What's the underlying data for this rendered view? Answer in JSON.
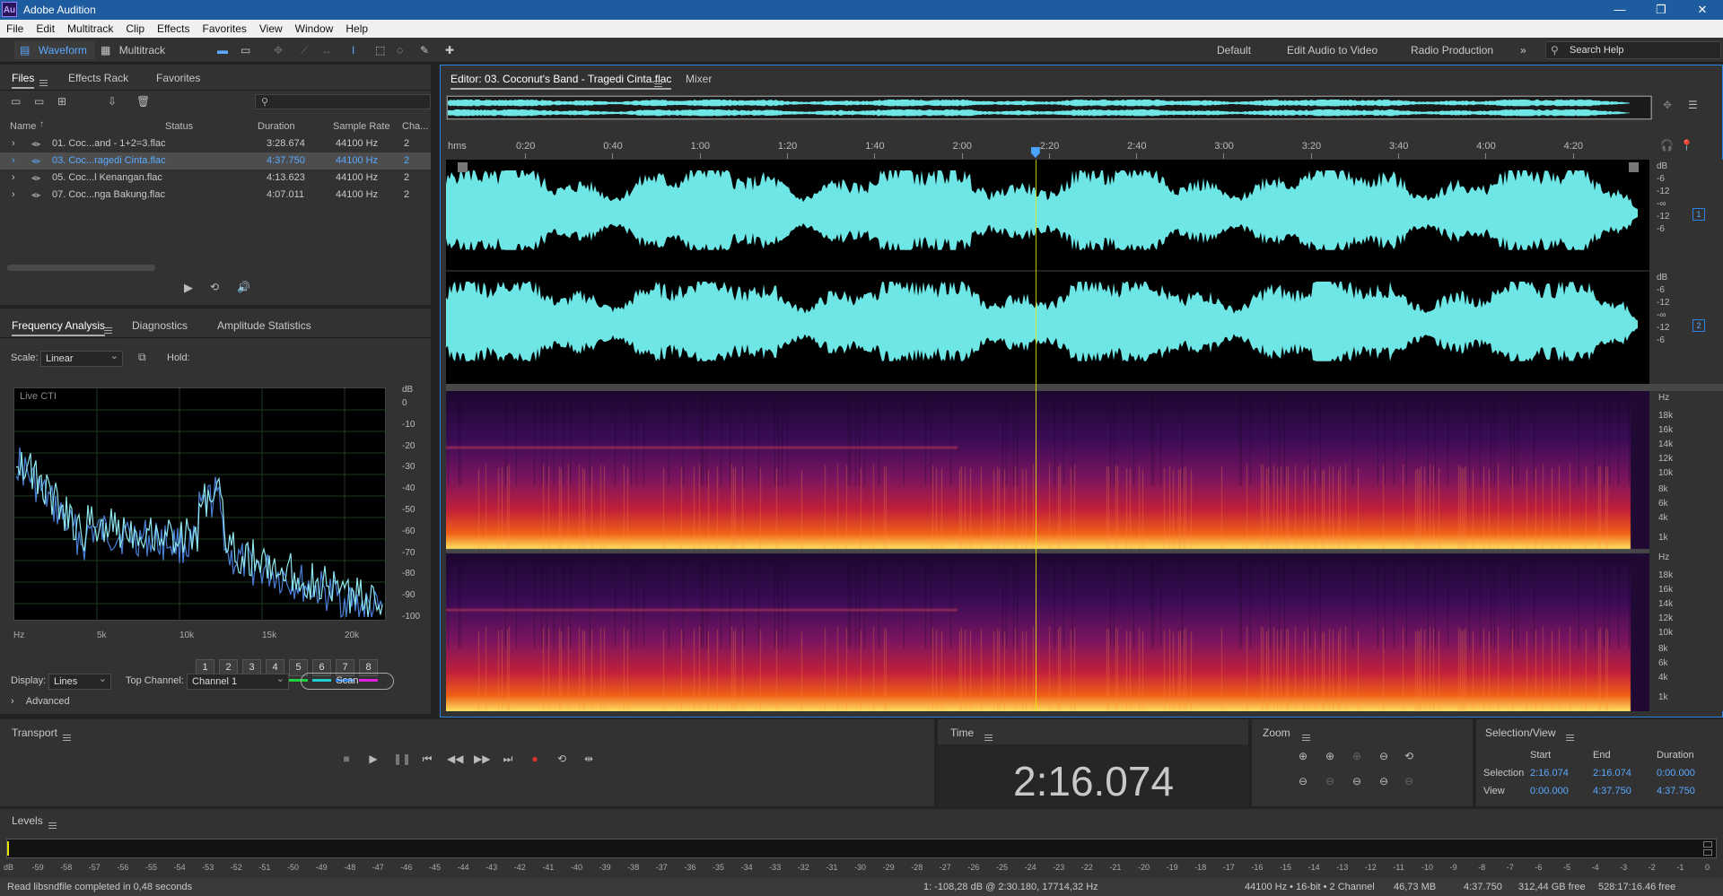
{
  "app": {
    "title": "Adobe Audition",
    "logo": "Au"
  },
  "menu": [
    "File",
    "Edit",
    "Multitrack",
    "Clip",
    "Effects",
    "Favorites",
    "View",
    "Window",
    "Help"
  ],
  "toolbar": {
    "waveform_label": "Waveform",
    "multitrack_label": "Multitrack",
    "workspaces": [
      "Default",
      "Edit Audio to Video",
      "Radio Production"
    ],
    "search_placeholder": "Search Help"
  },
  "files_panel": {
    "tabs": [
      "Files",
      "Effects Rack",
      "Favorites"
    ],
    "columns": [
      "Name",
      "Status",
      "Duration",
      "Sample Rate",
      "Cha..."
    ],
    "rows": [
      {
        "name": "01. Coc...and - 1+2=3.flac",
        "duration": "3:28.674",
        "rate": "44100 Hz",
        "ch": "2",
        "selected": false
      },
      {
        "name": "03. Coc...ragedi Cinta.flac",
        "duration": "4:37.750",
        "rate": "44100 Hz",
        "ch": "2",
        "selected": true
      },
      {
        "name": "05. Coc...l Kenangan.flac",
        "duration": "4:13.623",
        "rate": "44100 Hz",
        "ch": "2",
        "selected": false
      },
      {
        "name": "07. Coc...nga Bakung.flac",
        "duration": "4:07.011",
        "rate": "44100 Hz",
        "ch": "2",
        "selected": false
      }
    ]
  },
  "freq_panel": {
    "tabs": [
      "Frequency Analysis",
      "Diagnostics",
      "Amplitude Statistics"
    ],
    "scale_label": "Scale:",
    "scale_value": "Linear",
    "hold_label": "Hold:",
    "hold_buttons": [
      "1",
      "2",
      "3",
      "4",
      "5",
      "6",
      "7",
      "8"
    ],
    "hold_colors": [
      "#e02020",
      "#f08020",
      "#e8e820",
      "#80e020",
      "#20d040",
      "#20d0d0",
      "#2080f0",
      "#e020e0"
    ],
    "graph_label": "Live CTI",
    "db_ticks": [
      "dB",
      "0",
      "-10",
      "-20",
      "-30",
      "-40",
      "-50",
      "-60",
      "-70",
      "-80",
      "-90",
      "-100"
    ],
    "hz_ticks": [
      "Hz",
      "5k",
      "10k",
      "15k",
      "20k"
    ],
    "display_label": "Display:",
    "display_value": "Lines",
    "top_channel_label": "Top Channel:",
    "top_channel_value": "Channel 1",
    "scan_label": "Scan",
    "advanced_label": "Advanced"
  },
  "editor": {
    "tab_title": "Editor: 03. Coconut's Band - Tragedi Cinta.flac",
    "mixer_tab": "Mixer",
    "ruler_unit": "hms",
    "ruler_ticks": [
      "0:20",
      "0:40",
      "1:00",
      "1:20",
      "1:40",
      "2:00",
      "2:20",
      "2:40",
      "3:00",
      "3:20",
      "3:40",
      "4:00",
      "4:20"
    ],
    "db_scale": [
      "dB",
      "-6",
      "-12",
      "-∞",
      "-12",
      "-6"
    ],
    "channel_badges": [
      "1",
      "2"
    ],
    "hz_scale": [
      "Hz",
      "18k",
      "16k",
      "14k",
      "12k",
      "10k",
      "8k",
      "6k",
      "4k",
      "1k"
    ],
    "playhead_fraction": 0.4898
  },
  "transport": {
    "title": "Transport"
  },
  "time_panel": {
    "title": "Time",
    "value": "2:16.074"
  },
  "zoom_panel": {
    "title": "Zoom"
  },
  "selection_panel": {
    "title": "Selection/View",
    "headers": [
      "Start",
      "End",
      "Duration"
    ],
    "rows": [
      {
        "label": "Selection",
        "start": "2:16.074",
        "end": "2:16.074",
        "duration": "0:00.000"
      },
      {
        "label": "View",
        "start": "0:00.000",
        "end": "4:37.750",
        "duration": "4:37.750"
      }
    ]
  },
  "levels": {
    "title": "Levels",
    "ticks": [
      "dB",
      "-59",
      "-58",
      "-57",
      "-56",
      "-55",
      "-54",
      "-53",
      "-52",
      "-51",
      "-50",
      "-49",
      "-48",
      "-47",
      "-46",
      "-45",
      "-44",
      "-43",
      "-42",
      "-41",
      "-40",
      "-39",
      "-38",
      "-37",
      "-36",
      "-35",
      "-34",
      "-33",
      "-32",
      "-31",
      "-30",
      "-29",
      "-28",
      "-27",
      "-26",
      "-25",
      "-24",
      "-23",
      "-22",
      "-21",
      "-20",
      "-19",
      "-18",
      "-17",
      "-16",
      "-15",
      "-14",
      "-13",
      "-12",
      "-11",
      "-10",
      "-9",
      "-8",
      "-7",
      "-6",
      "-5",
      "-4",
      "-3",
      "-2",
      "-1",
      "0"
    ]
  },
  "status": {
    "message": "Read libsndfile completed in 0,48 seconds",
    "cursor_info": "1: -108,28 dB @ 2:30.180, 17714,32 Hz",
    "format": "44100 Hz • 16-bit • 2 Channel",
    "size": "46,73 MB",
    "duration": "4:37.750",
    "free": "312,44 GB free",
    "free_time": "528:17:16.46 free"
  },
  "colors": {
    "accent": "#2a83e0",
    "waveform": "#6ee6e6",
    "playhead": "#e6e600"
  }
}
